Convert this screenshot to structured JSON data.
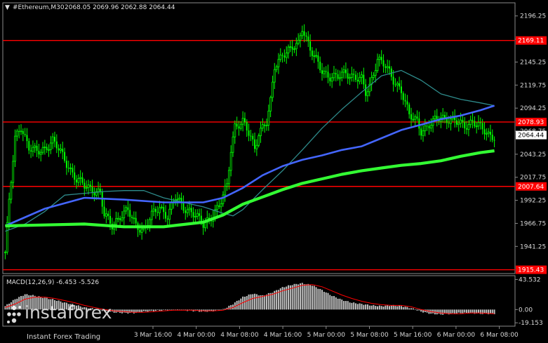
{
  "header": {
    "symbol": "#Ethereum,M30",
    "ohlc": "2068.05 2069.96 2062.88 2064.44"
  },
  "colors": {
    "background": "#000000",
    "candle_up": "#00ff00",
    "candle_down": "#00ff00",
    "level_line": "#ff0000",
    "ma_slow": "#33ff33",
    "ma_mid": "#4466ff",
    "ma_fast": "#2e8b8b",
    "macd_hist": "#c0c0c0",
    "macd_signal": "#ff0000",
    "current_price_bg": "#ffffff"
  },
  "watermark": {
    "brand": "instaforex",
    "tagline": "Instant Forex Trading"
  },
  "chart_data": [
    {
      "type": "candlestick",
      "panel": "price",
      "y_axis_ticks": [
        "2196.25",
        "2170.50",
        "2145.25",
        "2119.75",
        "2094.25",
        "2068.75",
        "2043.25",
        "2017.75",
        "1992.25",
        "1966.75",
        "1941.25"
      ],
      "ylim": [
        1912,
        2210
      ],
      "x_axis_ticks": [
        "3 Mar 16:00",
        "4 Mar 00:00",
        "4 Mar 08:00",
        "4 Mar 16:00",
        "5 Mar 00:00",
        "5 Mar 08:00",
        "5 Mar 16:00",
        "6 Mar 00:00",
        "6 Mar 08:00"
      ],
      "levels": [
        {
          "value": 2169.11,
          "label": "2169.11"
        },
        {
          "value": 2078.93,
          "label": "2078.93"
        },
        {
          "value": 2007.64,
          "label": "2007.64"
        },
        {
          "value": 1915.43,
          "label": "1915.43"
        }
      ],
      "current_price": {
        "value": 2064.44,
        "label": "2064.44"
      },
      "close_path": [
        [
          0,
          1935
        ],
        [
          2,
          1990
        ],
        [
          5,
          2060
        ],
        [
          8,
          2075
        ],
        [
          12,
          2050
        ],
        [
          16,
          2045
        ],
        [
          20,
          2050
        ],
        [
          24,
          2058
        ],
        [
          28,
          2045
        ],
        [
          32,
          2030
        ],
        [
          36,
          2015
        ],
        [
          40,
          2008
        ],
        [
          44,
          2005
        ],
        [
          48,
          2000
        ],
        [
          50,
          1975
        ],
        [
          54,
          1965
        ],
        [
          58,
          1975
        ],
        [
          62,
          1980
        ],
        [
          66,
          1965
        ],
        [
          70,
          1960
        ],
        [
          74,
          1975
        ],
        [
          78,
          1985
        ],
        [
          82,
          1975
        ],
        [
          86,
          1995
        ],
        [
          90,
          1985
        ],
        [
          94,
          1980
        ],
        [
          98,
          1970
        ],
        [
          100,
          1965
        ],
        [
          104,
          1975
        ],
        [
          108,
          1985
        ],
        [
          112,
          2008
        ],
        [
          114,
          2050
        ],
        [
          116,
          2075
        ],
        [
          120,
          2078
        ],
        [
          124,
          2062
        ],
        [
          126,
          2050
        ],
        [
          128,
          2068
        ],
        [
          132,
          2078
        ],
        [
          134,
          2100
        ],
        [
          136,
          2140
        ],
        [
          140,
          2155
        ],
        [
          144,
          2158
        ],
        [
          148,
          2165
        ],
        [
          150,
          2185
        ],
        [
          152,
          2172
        ],
        [
          154,
          2160
        ],
        [
          156,
          2150
        ],
        [
          160,
          2135
        ],
        [
          164,
          2130
        ],
        [
          168,
          2128
        ],
        [
          172,
          2133
        ],
        [
          176,
          2130
        ],
        [
          180,
          2125
        ],
        [
          182,
          2110
        ],
        [
          184,
          2118
        ],
        [
          188,
          2150
        ],
        [
          192,
          2140
        ],
        [
          196,
          2125
        ],
        [
          200,
          2115
        ],
        [
          204,
          2085
        ],
        [
          208,
          2080
        ],
        [
          210,
          2070
        ],
        [
          212,
          2072
        ],
        [
          216,
          2078
        ],
        [
          220,
          2085
        ],
        [
          224,
          2082
        ],
        [
          228,
          2078
        ],
        [
          232,
          2075
        ],
        [
          236,
          2080
        ],
        [
          240,
          2072
        ],
        [
          244,
          2065
        ],
        [
          247,
          2064
        ]
      ],
      "series": [
        {
          "kind": "ma_slow",
          "points": [
            [
              0,
              1964
            ],
            [
              20,
              1965
            ],
            [
              40,
              1966
            ],
            [
              60,
              1963
            ],
            [
              80,
              1963
            ],
            [
              100,
              1968
            ],
            [
              110,
              1976
            ],
            [
              120,
              1988
            ],
            [
              130,
              1996
            ],
            [
              140,
              2004
            ],
            [
              150,
              2011
            ],
            [
              160,
              2016
            ],
            [
              170,
              2021
            ],
            [
              180,
              2025
            ],
            [
              190,
              2028
            ],
            [
              200,
              2031
            ],
            [
              210,
              2033
            ],
            [
              220,
              2036
            ],
            [
              230,
              2041
            ],
            [
              240,
              2045
            ],
            [
              247,
              2047
            ]
          ]
        },
        {
          "kind": "ma_mid",
          "points": [
            [
              0,
              1964
            ],
            [
              20,
              1983
            ],
            [
              40,
              1995
            ],
            [
              60,
              1993
            ],
            [
              80,
              1990
            ],
            [
              100,
              1990
            ],
            [
              110,
              1995
            ],
            [
              120,
              2006
            ],
            [
              130,
              2020
            ],
            [
              140,
              2030
            ],
            [
              150,
              2037
            ],
            [
              160,
              2042
            ],
            [
              170,
              2048
            ],
            [
              180,
              2052
            ],
            [
              190,
              2061
            ],
            [
              200,
              2070
            ],
            [
              210,
              2076
            ],
            [
              220,
              2082
            ],
            [
              230,
              2086
            ],
            [
              240,
              2092
            ],
            [
              247,
              2097
            ]
          ]
        },
        {
          "kind": "ma_fast",
          "points": [
            [
              0,
              1958
            ],
            [
              10,
              1966
            ],
            [
              20,
              1980
            ],
            [
              30,
              1998
            ],
            [
              40,
              2000
            ],
            [
              50,
              2002
            ],
            [
              60,
              2003
            ],
            [
              70,
              2003
            ],
            [
              80,
              1995
            ],
            [
              90,
              1990
            ],
            [
              100,
              1985
            ],
            [
              110,
              1978
            ],
            [
              115,
              1975
            ],
            [
              120,
              1982
            ],
            [
              130,
              2004
            ],
            [
              140,
              2025
            ],
            [
              150,
              2048
            ],
            [
              160,
              2072
            ],
            [
              170,
              2093
            ],
            [
              180,
              2112
            ],
            [
              190,
              2130
            ],
            [
              200,
              2136
            ],
            [
              210,
              2125
            ],
            [
              220,
              2110
            ],
            [
              230,
              2104
            ],
            [
              240,
              2100
            ],
            [
              247,
              2097
            ]
          ]
        }
      ]
    },
    {
      "type": "bar",
      "panel": "macd",
      "title": "MACD(12,26,9) -6.453 -5.526",
      "y_axis_ticks": [
        "43.532",
        "0.00",
        "-19.153"
      ],
      "ylim": [
        -23,
        48
      ],
      "hist_path": [
        [
          0,
          5
        ],
        [
          5,
          15
        ],
        [
          10,
          22
        ],
        [
          15,
          20
        ],
        [
          20,
          17
        ],
        [
          25,
          14
        ],
        [
          30,
          10
        ],
        [
          35,
          7
        ],
        [
          40,
          3
        ],
        [
          45,
          1
        ],
        [
          50,
          -2
        ],
        [
          55,
          -4
        ],
        [
          60,
          -5
        ],
        [
          65,
          -5
        ],
        [
          70,
          -3
        ],
        [
          75,
          -2
        ],
        [
          80,
          -1
        ],
        [
          85,
          0
        ],
        [
          90,
          -1
        ],
        [
          95,
          -2
        ],
        [
          100,
          -3
        ],
        [
          105,
          -2
        ],
        [
          110,
          0
        ],
        [
          115,
          8
        ],
        [
          120,
          18
        ],
        [
          125,
          23
        ],
        [
          130,
          20
        ],
        [
          135,
          25
        ],
        [
          140,
          32
        ],
        [
          145,
          36
        ],
        [
          150,
          38
        ],
        [
          155,
          35
        ],
        [
          160,
          28
        ],
        [
          165,
          20
        ],
        [
          170,
          14
        ],
        [
          175,
          10
        ],
        [
          180,
          8
        ],
        [
          185,
          6
        ],
        [
          190,
          5
        ],
        [
          195,
          6
        ],
        [
          200,
          5
        ],
        [
          205,
          2
        ],
        [
          210,
          -3
        ],
        [
          215,
          -6
        ],
        [
          220,
          -7
        ],
        [
          225,
          -6
        ],
        [
          230,
          -5
        ],
        [
          235,
          -5
        ],
        [
          240,
          -6
        ],
        [
          247,
          -6
        ]
      ],
      "signal_path": [
        [
          0,
          3
        ],
        [
          5,
          8
        ],
        [
          10,
          15
        ],
        [
          15,
          18
        ],
        [
          20,
          18
        ],
        [
          25,
          16
        ],
        [
          30,
          13
        ],
        [
          35,
          10
        ],
        [
          40,
          6
        ],
        [
          45,
          3
        ],
        [
          50,
          0
        ],
        [
          55,
          -2
        ],
        [
          60,
          -3
        ],
        [
          65,
          -4
        ],
        [
          70,
          -4
        ],
        [
          75,
          -3
        ],
        [
          80,
          -2
        ],
        [
          85,
          -1
        ],
        [
          90,
          -1
        ],
        [
          95,
          -1
        ],
        [
          100,
          -2
        ],
        [
          105,
          -2
        ],
        [
          110,
          -1
        ],
        [
          115,
          3
        ],
        [
          120,
          10
        ],
        [
          125,
          16
        ],
        [
          130,
          19
        ],
        [
          135,
          22
        ],
        [
          140,
          27
        ],
        [
          145,
          31
        ],
        [
          150,
          35
        ],
        [
          155,
          36
        ],
        [
          160,
          33
        ],
        [
          165,
          27
        ],
        [
          170,
          21
        ],
        [
          175,
          16
        ],
        [
          180,
          12
        ],
        [
          185,
          9
        ],
        [
          190,
          7
        ],
        [
          195,
          6
        ],
        [
          200,
          6
        ],
        [
          205,
          4
        ],
        [
          210,
          0
        ],
        [
          215,
          -3
        ],
        [
          220,
          -5
        ],
        [
          225,
          -6
        ],
        [
          230,
          -6
        ],
        [
          235,
          -5
        ],
        [
          240,
          -5
        ],
        [
          247,
          -6
        ]
      ]
    }
  ]
}
